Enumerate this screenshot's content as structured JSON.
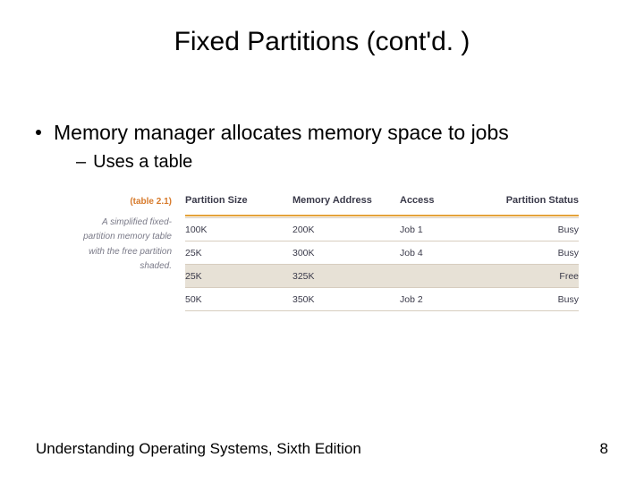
{
  "title": "Fixed Partitions (cont'd. )",
  "bullets": {
    "main": "Memory manager allocates memory space to jobs",
    "sub": "Uses a table"
  },
  "table": {
    "label": "(table 2.1)",
    "caption_line1": "A simplified fixed-",
    "caption_line2": "partition memory table",
    "caption_line3": "with the free partition",
    "caption_line4": "shaded.",
    "headers": {
      "size": "Partition Size",
      "addr": "Memory Address",
      "access": "Access",
      "status": "Partition Status"
    },
    "rows": [
      {
        "size": "100K",
        "addr": "200K",
        "access": "Job 1",
        "status": "Busy",
        "free": false
      },
      {
        "size": "25K",
        "addr": "300K",
        "access": "Job 4",
        "status": "Busy",
        "free": false
      },
      {
        "size": "25K",
        "addr": "325K",
        "access": "",
        "status": "Free",
        "free": true
      },
      {
        "size": "50K",
        "addr": "350K",
        "access": "Job 2",
        "status": "Busy",
        "free": false
      }
    ]
  },
  "footer": {
    "left": "Understanding Operating Systems, Sixth Edition",
    "page": "8"
  }
}
